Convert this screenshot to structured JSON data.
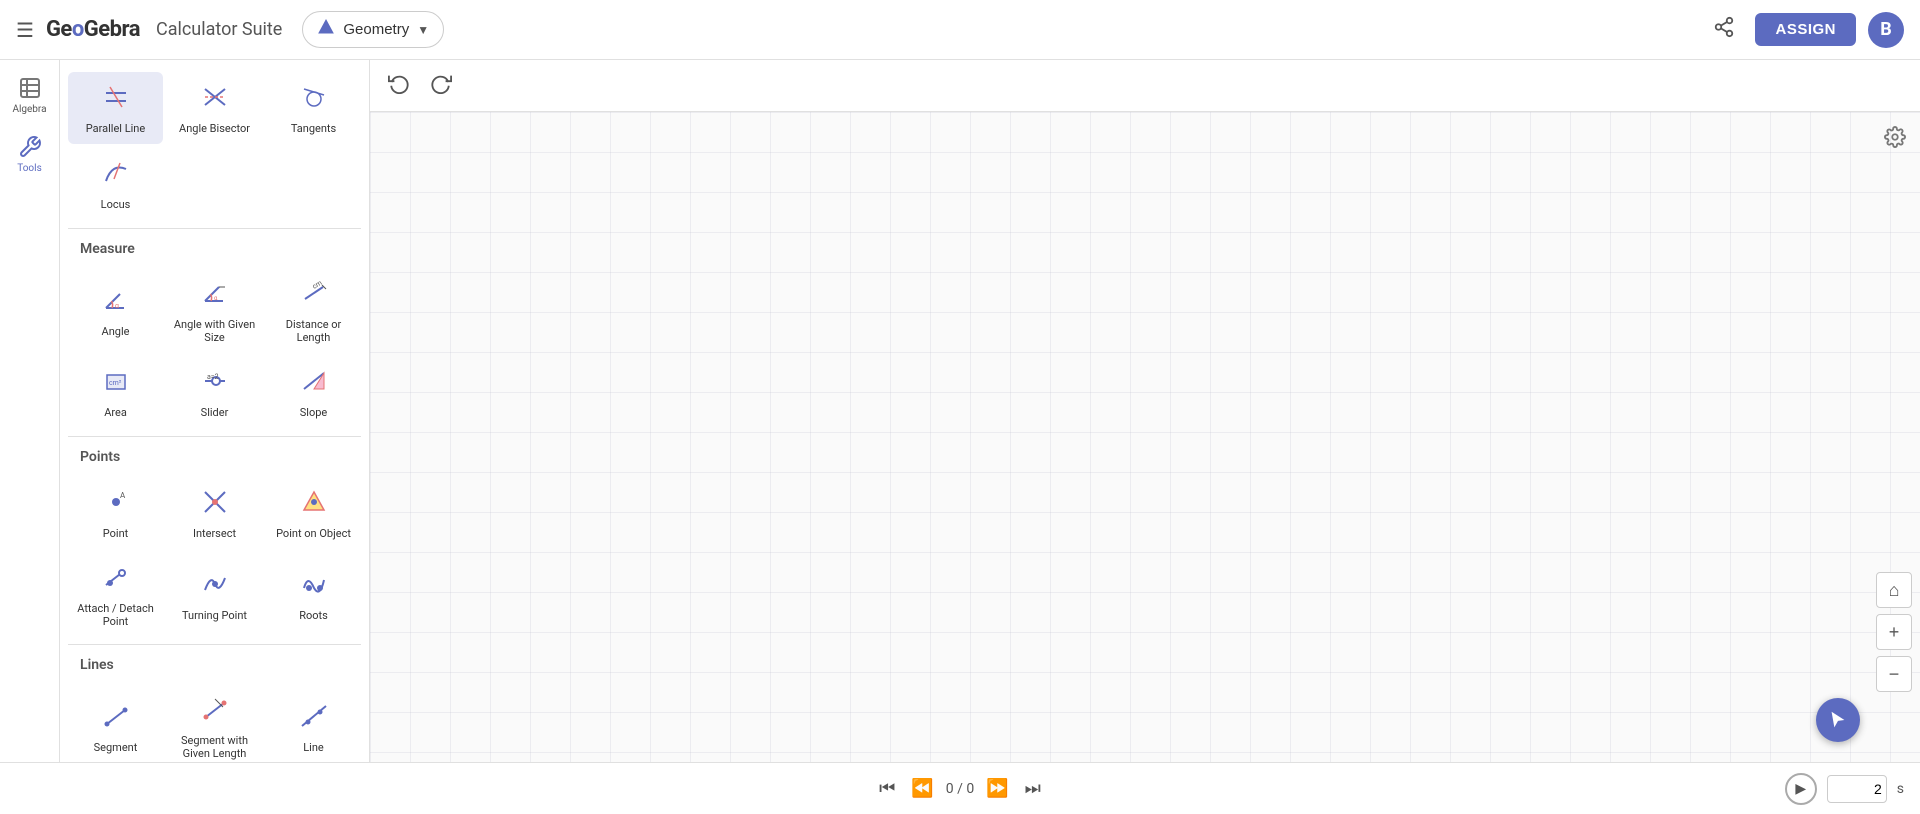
{
  "topbar": {
    "menu_icon": "☰",
    "logo": "GeoGebra",
    "suite": "Calculator Suite",
    "app_dropdown": {
      "label": "Geometry",
      "icon": "▲"
    },
    "assign_label": "ASSIGN",
    "avatar_letter": "B",
    "share_icon": "share"
  },
  "sidebar": {
    "items": [
      {
        "id": "algebra",
        "label": "Algebra",
        "icon": "algebra"
      },
      {
        "id": "tools",
        "label": "Tools",
        "icon": "tools",
        "active": true
      }
    ]
  },
  "tools_panel": {
    "sections": [
      {
        "id": "measure",
        "title": "Measure",
        "tools": [
          {
            "id": "angle",
            "label": "Angle",
            "icon": "angle"
          },
          {
            "id": "angle-given-size",
            "label": "Angle with Given Size",
            "icon": "angle-given-size"
          },
          {
            "id": "distance-or-length",
            "label": "Distance or Length",
            "icon": "distance"
          },
          {
            "id": "area",
            "label": "Area",
            "icon": "area"
          },
          {
            "id": "slider",
            "label": "Slider",
            "icon": "slider"
          },
          {
            "id": "slope",
            "label": "Slope",
            "icon": "slope"
          }
        ]
      },
      {
        "id": "points",
        "title": "Points",
        "tools": [
          {
            "id": "point",
            "label": "Point",
            "icon": "point"
          },
          {
            "id": "intersect",
            "label": "Intersect",
            "icon": "intersect"
          },
          {
            "id": "point-on-object",
            "label": "Point on Object",
            "icon": "point-on-object"
          },
          {
            "id": "attach-detach-point",
            "label": "Attach / Detach Point",
            "icon": "attach-detach"
          },
          {
            "id": "turning-point",
            "label": "Turning Point",
            "icon": "turning-point"
          },
          {
            "id": "roots",
            "label": "Roots",
            "icon": "roots"
          }
        ]
      },
      {
        "id": "lines",
        "title": "Lines",
        "tools": [
          {
            "id": "segment",
            "label": "Segment",
            "icon": "segment"
          },
          {
            "id": "segment-given-length",
            "label": "Segment with Given Length",
            "icon": "segment-given-length"
          },
          {
            "id": "line",
            "label": "Line",
            "icon": "line"
          }
        ]
      }
    ],
    "above_sections": [
      {
        "id": "construct",
        "tools": [
          {
            "id": "parallel-line",
            "label": "Parallel Line",
            "icon": "parallel-line",
            "active": true
          },
          {
            "id": "angle-bisector",
            "label": "Angle Bisector",
            "icon": "angle-bisector"
          },
          {
            "id": "tangents",
            "label": "Tangents",
            "icon": "tangents"
          },
          {
            "id": "locus",
            "label": "Locus",
            "icon": "locus"
          }
        ]
      }
    ]
  },
  "canvas": {
    "undo_icon": "↩",
    "redo_icon": "↪",
    "settings_icon": "⚙"
  },
  "bottom_bar": {
    "skip_back_icon": "⏮",
    "fast_back_icon": "⏪",
    "progress": "0 / 0",
    "fast_forward_icon": "⏩",
    "skip_forward_icon": "⏭",
    "play_icon": "▶",
    "speed_value": "2",
    "speed_unit": "s"
  },
  "zoom": {
    "home_icon": "⌂",
    "zoom_in_icon": "+",
    "zoom_out_icon": "−"
  },
  "cursor": {
    "icon": "↖"
  }
}
